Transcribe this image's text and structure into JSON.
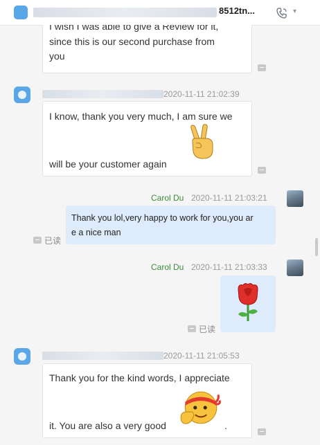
{
  "header": {
    "title_suffix": "8512tn...",
    "caret_glyph": "▾"
  },
  "messages": [
    {
      "lines": [
        "I wish I was able to give a Review for it,",
        "since this is our second purchase from",
        "you"
      ]
    },
    {
      "time": "2020-11-11 21:02:39",
      "lines": [
        "I know, thank you very much, I am sure we",
        "will be your customer again"
      ],
      "emoji": "victory-hand"
    },
    {
      "sender": "Carol Du",
      "time": "2020-11-11 21:03:21",
      "lines": [
        "Thank you lol,very happy to work for you,you ar",
        "e a nice man"
      ],
      "status": "已读"
    },
    {
      "sender": "Carol Du",
      "time": "2020-11-11 21:03:33",
      "emoji": "rose",
      "status": "已读"
    },
    {
      "time": "2020-11-11 21:05:53",
      "lines": [
        "Thank you for the kind words, I appreciate",
        "it. You are also a very good",
        "."
      ],
      "emoji": "determined-face"
    }
  ],
  "colors": {
    "incoming_bubble": "#ffffff",
    "outgoing_bubble": "#ddebfb",
    "sender_name": "#3c8b3c",
    "avatar": "#5aa6e6"
  }
}
